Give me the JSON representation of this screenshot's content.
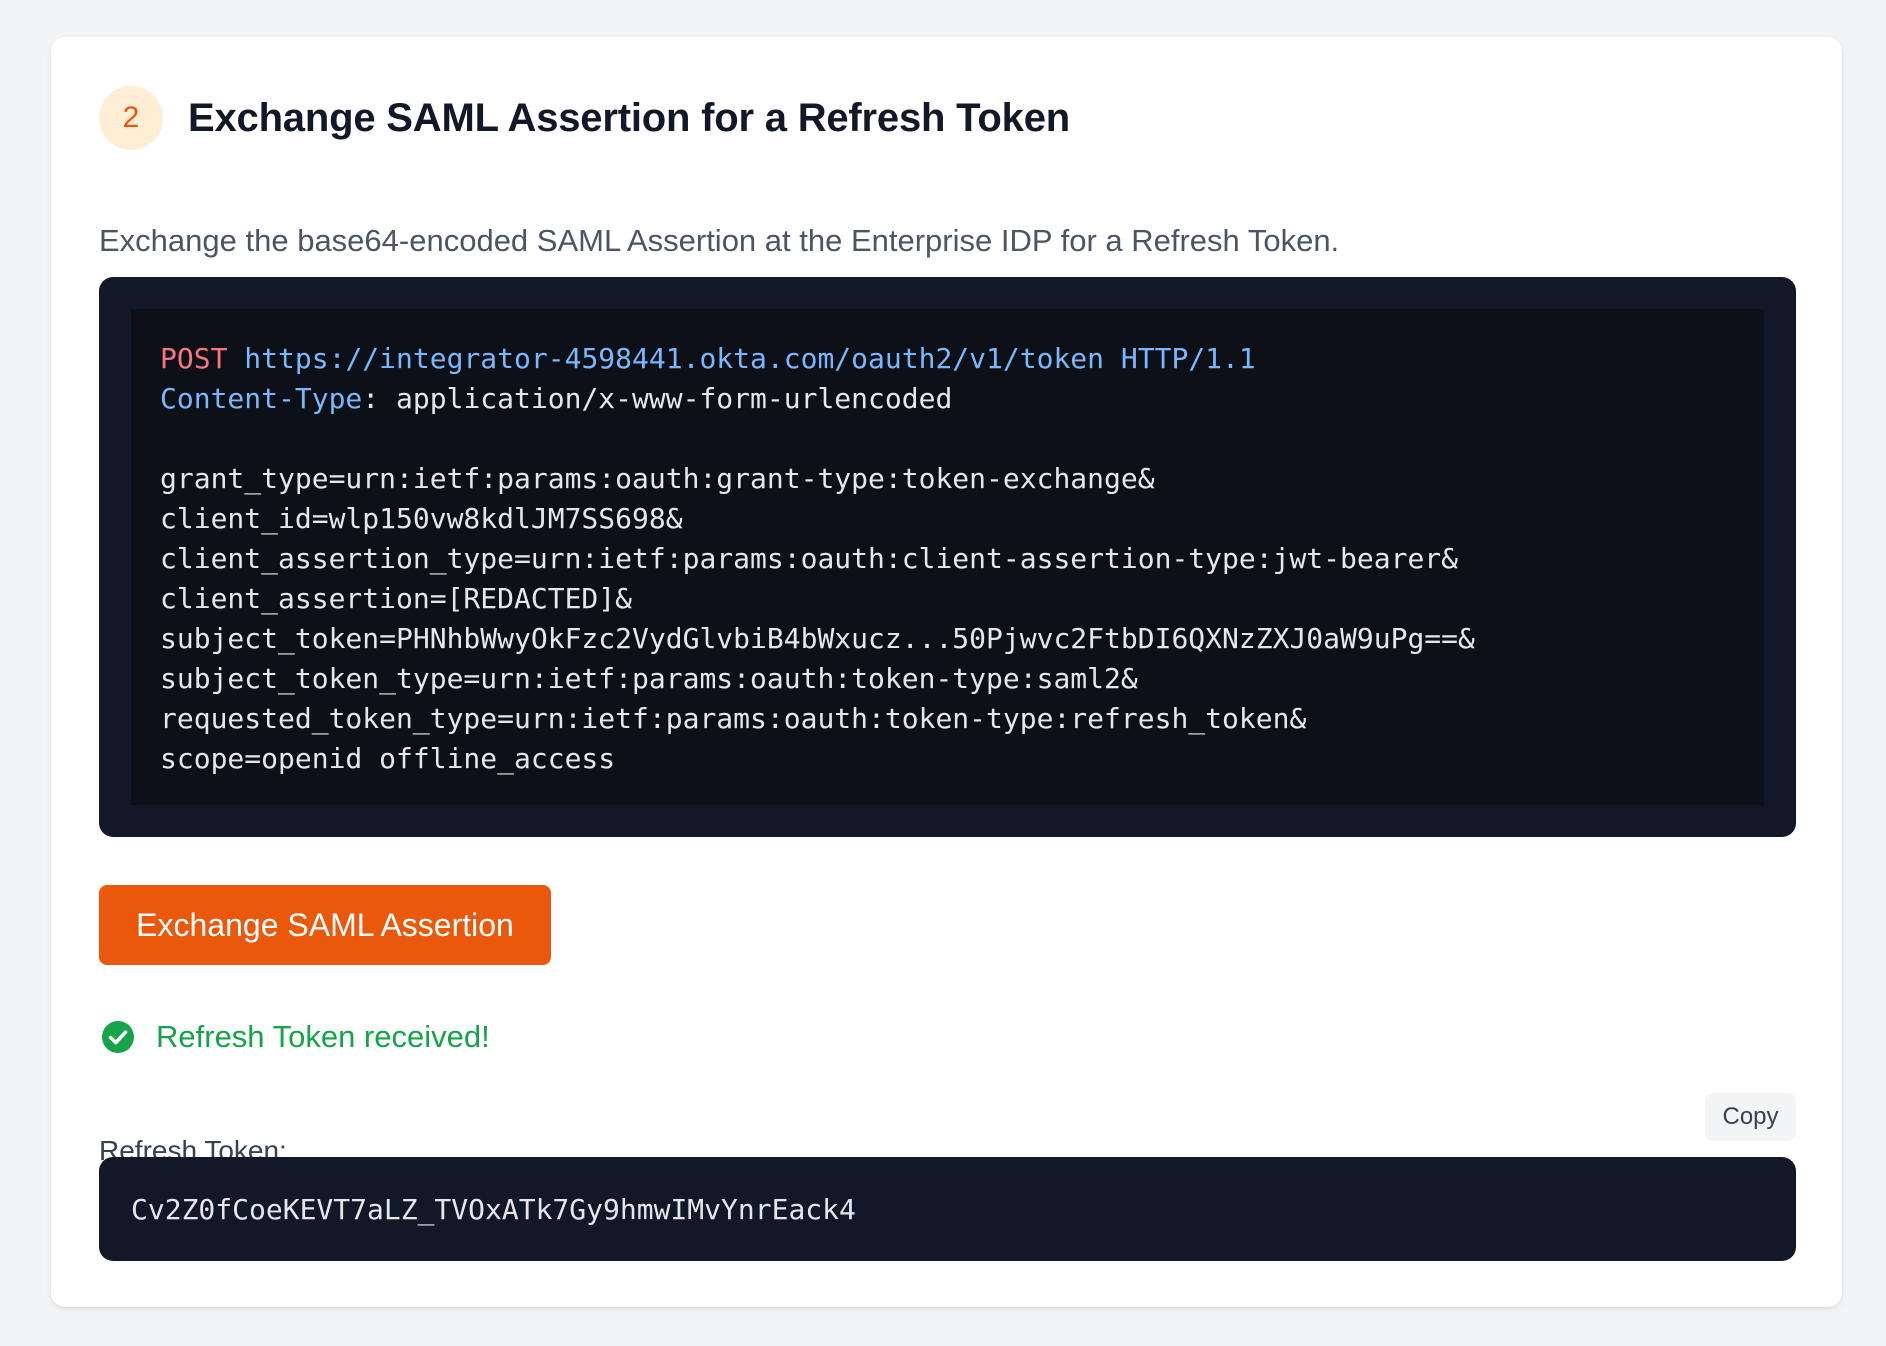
{
  "step": {
    "number": "2",
    "title": "Exchange SAML Assertion for a Refresh Token",
    "description": "Exchange the base64-encoded SAML Assertion at the Enterprise IDP for a Refresh Token."
  },
  "request": {
    "method": "POST",
    "url": "https://integrator-4598441.okta.com/oauth2/v1/token",
    "protocol": "HTTP/1.1",
    "header_name": "Content-Type",
    "header_sep": ":",
    "header_value": " application/x-www-form-urlencoded",
    "body_lines": [
      "grant_type=urn:ietf:params:oauth:grant-type:token-exchange&",
      "client_id=wlp150vw8kdlJM7SS698&",
      "client_assertion_type=urn:ietf:params:oauth:client-assertion-type:jwt-bearer&",
      "client_assertion=[REDACTED]&",
      "subject_token=PHNhbWwyOkFzc2VydGlvbiB4bWxucz...50Pjwvc2FtbDI6QXNzZXJ0aW9uPg==&",
      "subject_token_type=urn:ietf:params:oauth:token-type:saml2&",
      "requested_token_type=urn:ietf:params:oauth:token-type:refresh_token&",
      "scope=openid offline_access"
    ]
  },
  "actions": {
    "exchange_label": "Exchange SAML Assertion"
  },
  "status": {
    "icon": "check-circle-icon",
    "message": "Refresh Token received!"
  },
  "token": {
    "label": "Refresh Token:",
    "copy_label": "Copy",
    "value": "Cv2Z0fCoeKEVT7aLZ_TVOxATk7Gy9hmwIMvYnrEack4"
  },
  "colors": {
    "accent": "#ea580c",
    "badge_bg": "#ffedd5",
    "success": "#16a34a",
    "code_bg": "#111827"
  }
}
